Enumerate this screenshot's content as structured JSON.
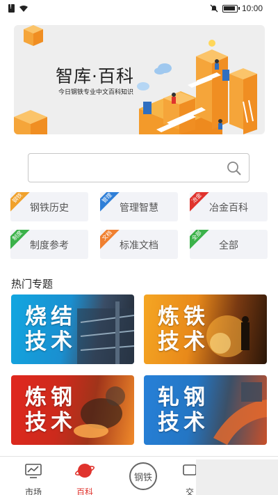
{
  "status_bar": {
    "time": "10:00"
  },
  "banner": {
    "title": "智库·百科",
    "subtitle": "今日钢铁专业中文百科知识"
  },
  "search": {
    "placeholder": ""
  },
  "categories": [
    {
      "label": "钢铁历史",
      "tag": "钢铁",
      "color": "#f0a12c"
    },
    {
      "label": "管理智慧",
      "tag": "管理",
      "color": "#2f7fd8"
    },
    {
      "label": "冶金百科",
      "tag": "冶金",
      "color": "#e0332d"
    },
    {
      "label": "制度参考",
      "tag": "制度",
      "color": "#3bb24a"
    },
    {
      "label": "标准文档",
      "tag": "文档",
      "color": "#f08030"
    },
    {
      "label": "全部",
      "tag": "全部",
      "color": "#3bb24a"
    }
  ],
  "hot_section": {
    "title": "热门专题"
  },
  "topics": [
    {
      "line1": "烧结",
      "line2": "技术"
    },
    {
      "line1": "炼铁",
      "line2": "技术"
    },
    {
      "line1": "炼钢",
      "line2": "技术"
    },
    {
      "line1": "轧钢",
      "line2": "技术"
    }
  ],
  "bottom_nav": {
    "market": "市场",
    "baike": "百科",
    "center_icon": "钢铁",
    "trade": "交"
  }
}
